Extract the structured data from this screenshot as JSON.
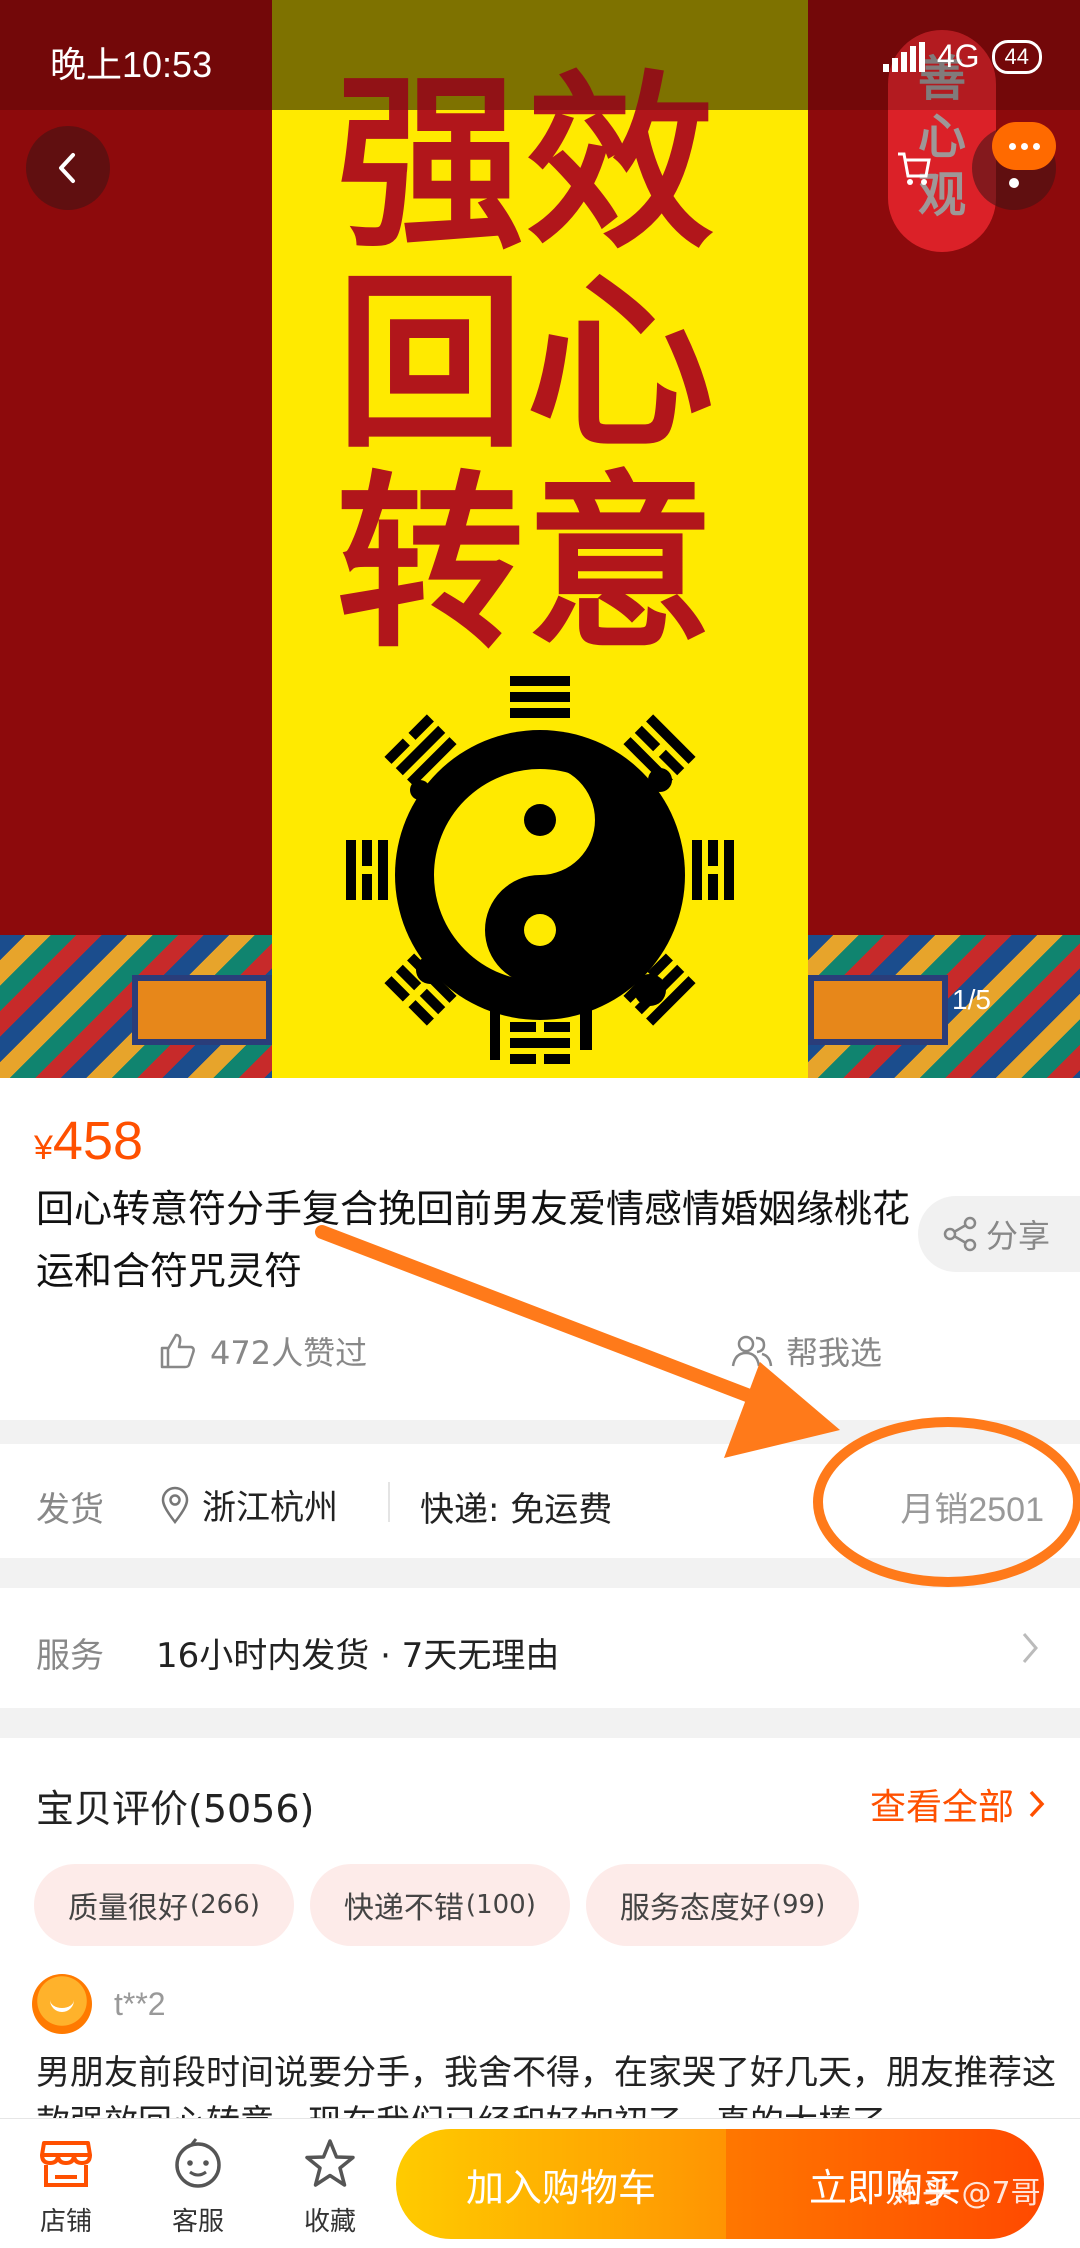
{
  "status_bar": {
    "time": "晚上10:53",
    "network": "4G",
    "battery": "44"
  },
  "hero": {
    "chars": [
      "强",
      "效",
      "回",
      "心",
      "转",
      "意"
    ],
    "seal_text": [
      "善",
      "心",
      "观"
    ],
    "counter": "1/5",
    "colors": {
      "red": "#8d0a0c",
      "yellow": "#ffea00",
      "char": "#b1161b"
    }
  },
  "product": {
    "currency": "¥",
    "price": "458",
    "title": "回心转意符分手复合挽回前男友爱情感情婚姻缘桃花运和合符咒灵符",
    "share_label": "分享",
    "likes_label": "472人赞过",
    "help_label": "帮我选"
  },
  "shipping": {
    "label": "发货",
    "location": "浙江杭州",
    "express": "快递: 免运费",
    "monthly_sales": "月销2501"
  },
  "service": {
    "label": "服务",
    "text": "16小时内发货 · 7天无理由"
  },
  "reviews": {
    "title": "宝贝评价(5056)",
    "view_all": "查看全部",
    "tags": [
      {
        "label": "质量很好",
        "count": "(266)"
      },
      {
        "label": "快递不错",
        "count": "(100)"
      },
      {
        "label": "服务态度好",
        "count": "(99)"
      }
    ],
    "reviewer": "t**2",
    "text": "男朋友前段时间说要分手，我舍不得，在家哭了好几天，朋友推荐这款强效回心转意，现在我们已经和好如初了，真的太棒了"
  },
  "bottom_bar": {
    "shop": "店铺",
    "service": "客服",
    "favorite": "收藏",
    "add_to_cart": "加入购物车",
    "buy_now": "立即购买"
  },
  "watermark": "知乎 @7哥",
  "accent_color": "#ff5000"
}
